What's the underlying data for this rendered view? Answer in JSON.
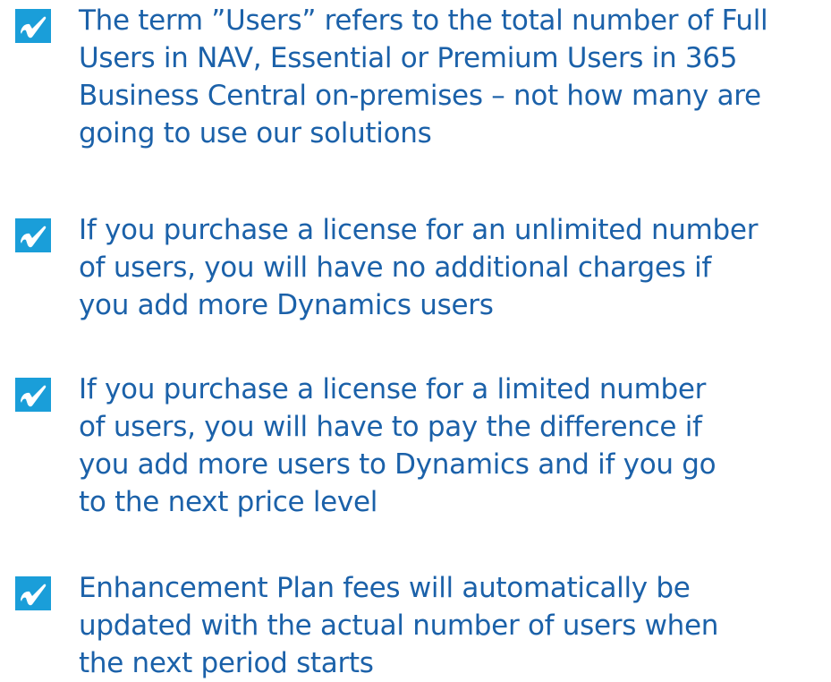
{
  "icon": "checkbox-check-icon",
  "colors": {
    "text": "#1b61a9",
    "icon_background": "#1a9ed9",
    "icon_check": "#ffffff"
  },
  "items": [
    {
      "text": "The term ”Users” refers to the total number of Full\nUsers in NAV, Essential or Premium Users in 365\nBusiness Central on-premises – not how many are\ngoing to use our solutions"
    },
    {
      "text": "If you purchase a license for an unlimited number\nof users, you will have no additional charges if\nyou add more Dynamics users"
    },
    {
      "text": "If you purchase a license for a limited number\nof users, you will have to pay the difference if\nyou add more users to Dynamics and if you go\nto the next price level"
    },
    {
      "text": "Enhancement Plan fees will automatically be\nupdated with the actual number of users when\nthe next period starts"
    }
  ]
}
